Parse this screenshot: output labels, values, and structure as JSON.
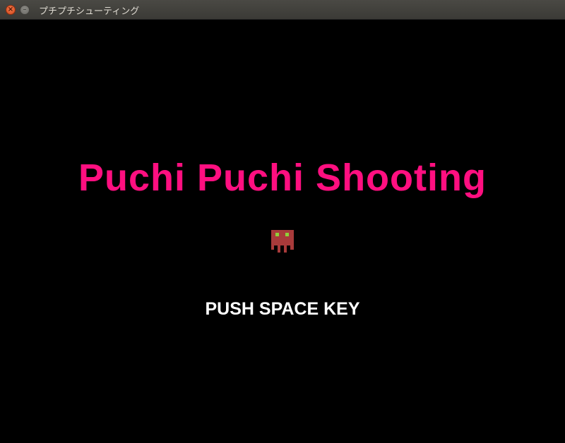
{
  "window": {
    "title": "プチプチシューティング",
    "close_glyph": "×",
    "minimize_glyph": "–"
  },
  "game": {
    "title": "Puchi Puchi Shooting",
    "prompt": "PUSH SPACE KEY",
    "enemy_icon": "octopus-enemy-icon",
    "colors": {
      "background": "#000000",
      "title": "#ff0f80",
      "prompt": "#ffffff",
      "enemy_body": "#a83a3a",
      "enemy_eyes": "#8fd13a"
    }
  }
}
